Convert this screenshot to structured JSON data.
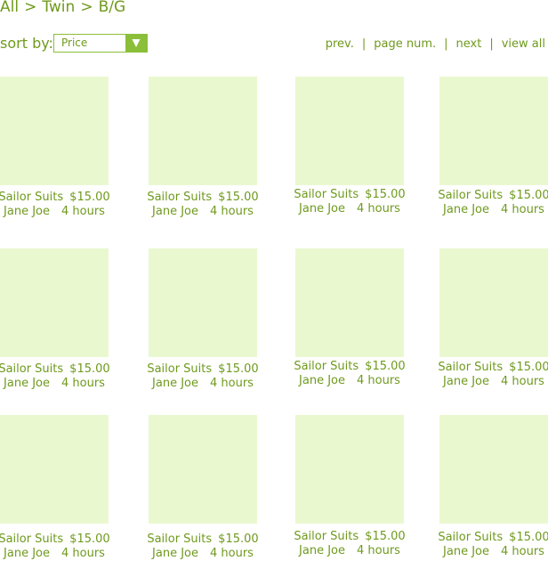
{
  "breadcrumb": {
    "items": [
      "All",
      "Twin",
      "B/G"
    ],
    "separator": ">"
  },
  "sort": {
    "label": "sort by:",
    "selected": "Price"
  },
  "pager": {
    "prev": "prev.",
    "page_num": "page num.",
    "next": "next",
    "view_all": "view all",
    "separator": "|"
  },
  "colors": {
    "text": "#6f9a1d",
    "accent": "#8bbf3a",
    "thumbnail": "#eaf8d0"
  },
  "products": [
    {
      "title": "Sailor Suits",
      "price": "$15.00",
      "seller": "Jane Joe",
      "time": "4 hours"
    },
    {
      "title": "Sailor Suits",
      "price": "$15.00",
      "seller": "Jane Joe",
      "time": "4 hours"
    },
    {
      "title": "Sailor Suits",
      "price": "$15.00",
      "seller": "Jane Joe",
      "time": "4 hours"
    },
    {
      "title": "Sailor Suits",
      "price": "$15.00",
      "seller": "Jane Joe",
      "time": "4 hours"
    },
    {
      "title": "Sailor Suits",
      "price": "$15.00",
      "seller": "Jane Joe",
      "time": "4 hours"
    },
    {
      "title": "Sailor Suits",
      "price": "$15.00",
      "seller": "Jane Joe",
      "time": "4 hours"
    },
    {
      "title": "Sailor Suits",
      "price": "$15.00",
      "seller": "Jane Joe",
      "time": "4 hours"
    },
    {
      "title": "Sailor Suits",
      "price": "$15.00",
      "seller": "Jane Joe",
      "time": "4 hours"
    },
    {
      "title": "Sailor Suits",
      "price": "$15.00",
      "seller": "Jane Joe",
      "time": "4 hours"
    },
    {
      "title": "Sailor Suits",
      "price": "$15.00",
      "seller": "Jane Joe",
      "time": "4 hours"
    },
    {
      "title": "Sailor Suits",
      "price": "$15.00",
      "seller": "Jane Joe",
      "time": "4 hours"
    },
    {
      "title": "Sailor Suits",
      "price": "$15.00",
      "seller": "Jane Joe",
      "time": "4 hours"
    }
  ]
}
